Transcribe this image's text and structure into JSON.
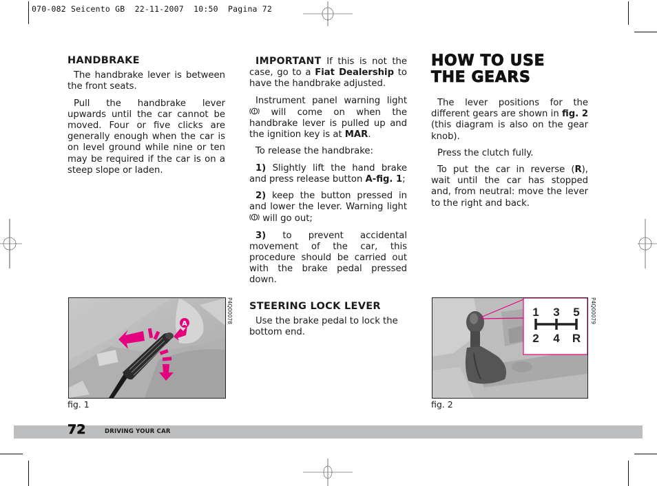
{
  "slug_line": "070-082 Seicento GB  22-11-2007  10:50  Pagina 72",
  "left_column": {
    "heading": "HANDBRAKE",
    "paragraphs": [
      "The handbrake lever is between the front seats.",
      "Pull the handbrake lever upwards until the car cannot be moved. Four or five clicks are generally enough when the car is on level ground while nine or ten may be required if the car is on a steep slope or laden."
    ]
  },
  "middle_column": {
    "important_label": "IMPORTANT",
    "important_text_1": " If this is not the case, go to a ",
    "important_bold": "Fiat Dealership",
    "important_text_2": " to have the handbrake adjusted.",
    "warning_text_1": "Instrument panel warning light ",
    "warning_text_2": " will come on when the handbrake lever is pulled up and the ignition key is at ",
    "warning_bold": "MAR",
    "warning_end": ".",
    "release_intro": "To release the handbrake:",
    "step1_num": "1)",
    "step1_text": " Slightly lift the hand brake and press release button ",
    "step1_bold": "A-fig. 1",
    "step1_end": ";",
    "step2_num": "2)",
    "step2_text_1": " keep the button pressed in and lower the lever. Warning light ",
    "step2_text_2": " will go out;",
    "step3_num": "3)",
    "step3_text": " to prevent accidental movement of the car, this procedure should be carried out with the brake pedal pressed down.",
    "steering_heading": "STEERING LOCK LEVER",
    "steering_text": "Use the brake pedal to lock the bottom end."
  },
  "right_column": {
    "title_line1": "HOW TO USE",
    "title_line2": "THE GEARS",
    "p1_text_1": "The lever positions for the different gears are shown in ",
    "p1_bold": "fig. 2",
    "p1_text_2": " (this diagram is also on the gear knob).",
    "p2": "Press the clutch fully.",
    "p3_text_1": "To put the car in reverse (",
    "p3_bold": "R",
    "p3_text_2": "), wait until the car has stopped and, from neutral: move the lever to the right and back."
  },
  "figure1": {
    "caption": "fig. 1",
    "code": "P4Q00078",
    "callout": "A",
    "accent_color": "#e5007e"
  },
  "figure2": {
    "caption": "fig. 2",
    "code": "P4Q00079",
    "gear_top": [
      "1",
      "3",
      "5"
    ],
    "gear_bottom": [
      "2",
      "4",
      "R"
    ],
    "accent_color": "#e5007e"
  },
  "footer": {
    "page_number": "72",
    "section": "DRIVING YOUR CAR"
  },
  "icons": {
    "warning_light": "handbrake-warning-icon"
  }
}
